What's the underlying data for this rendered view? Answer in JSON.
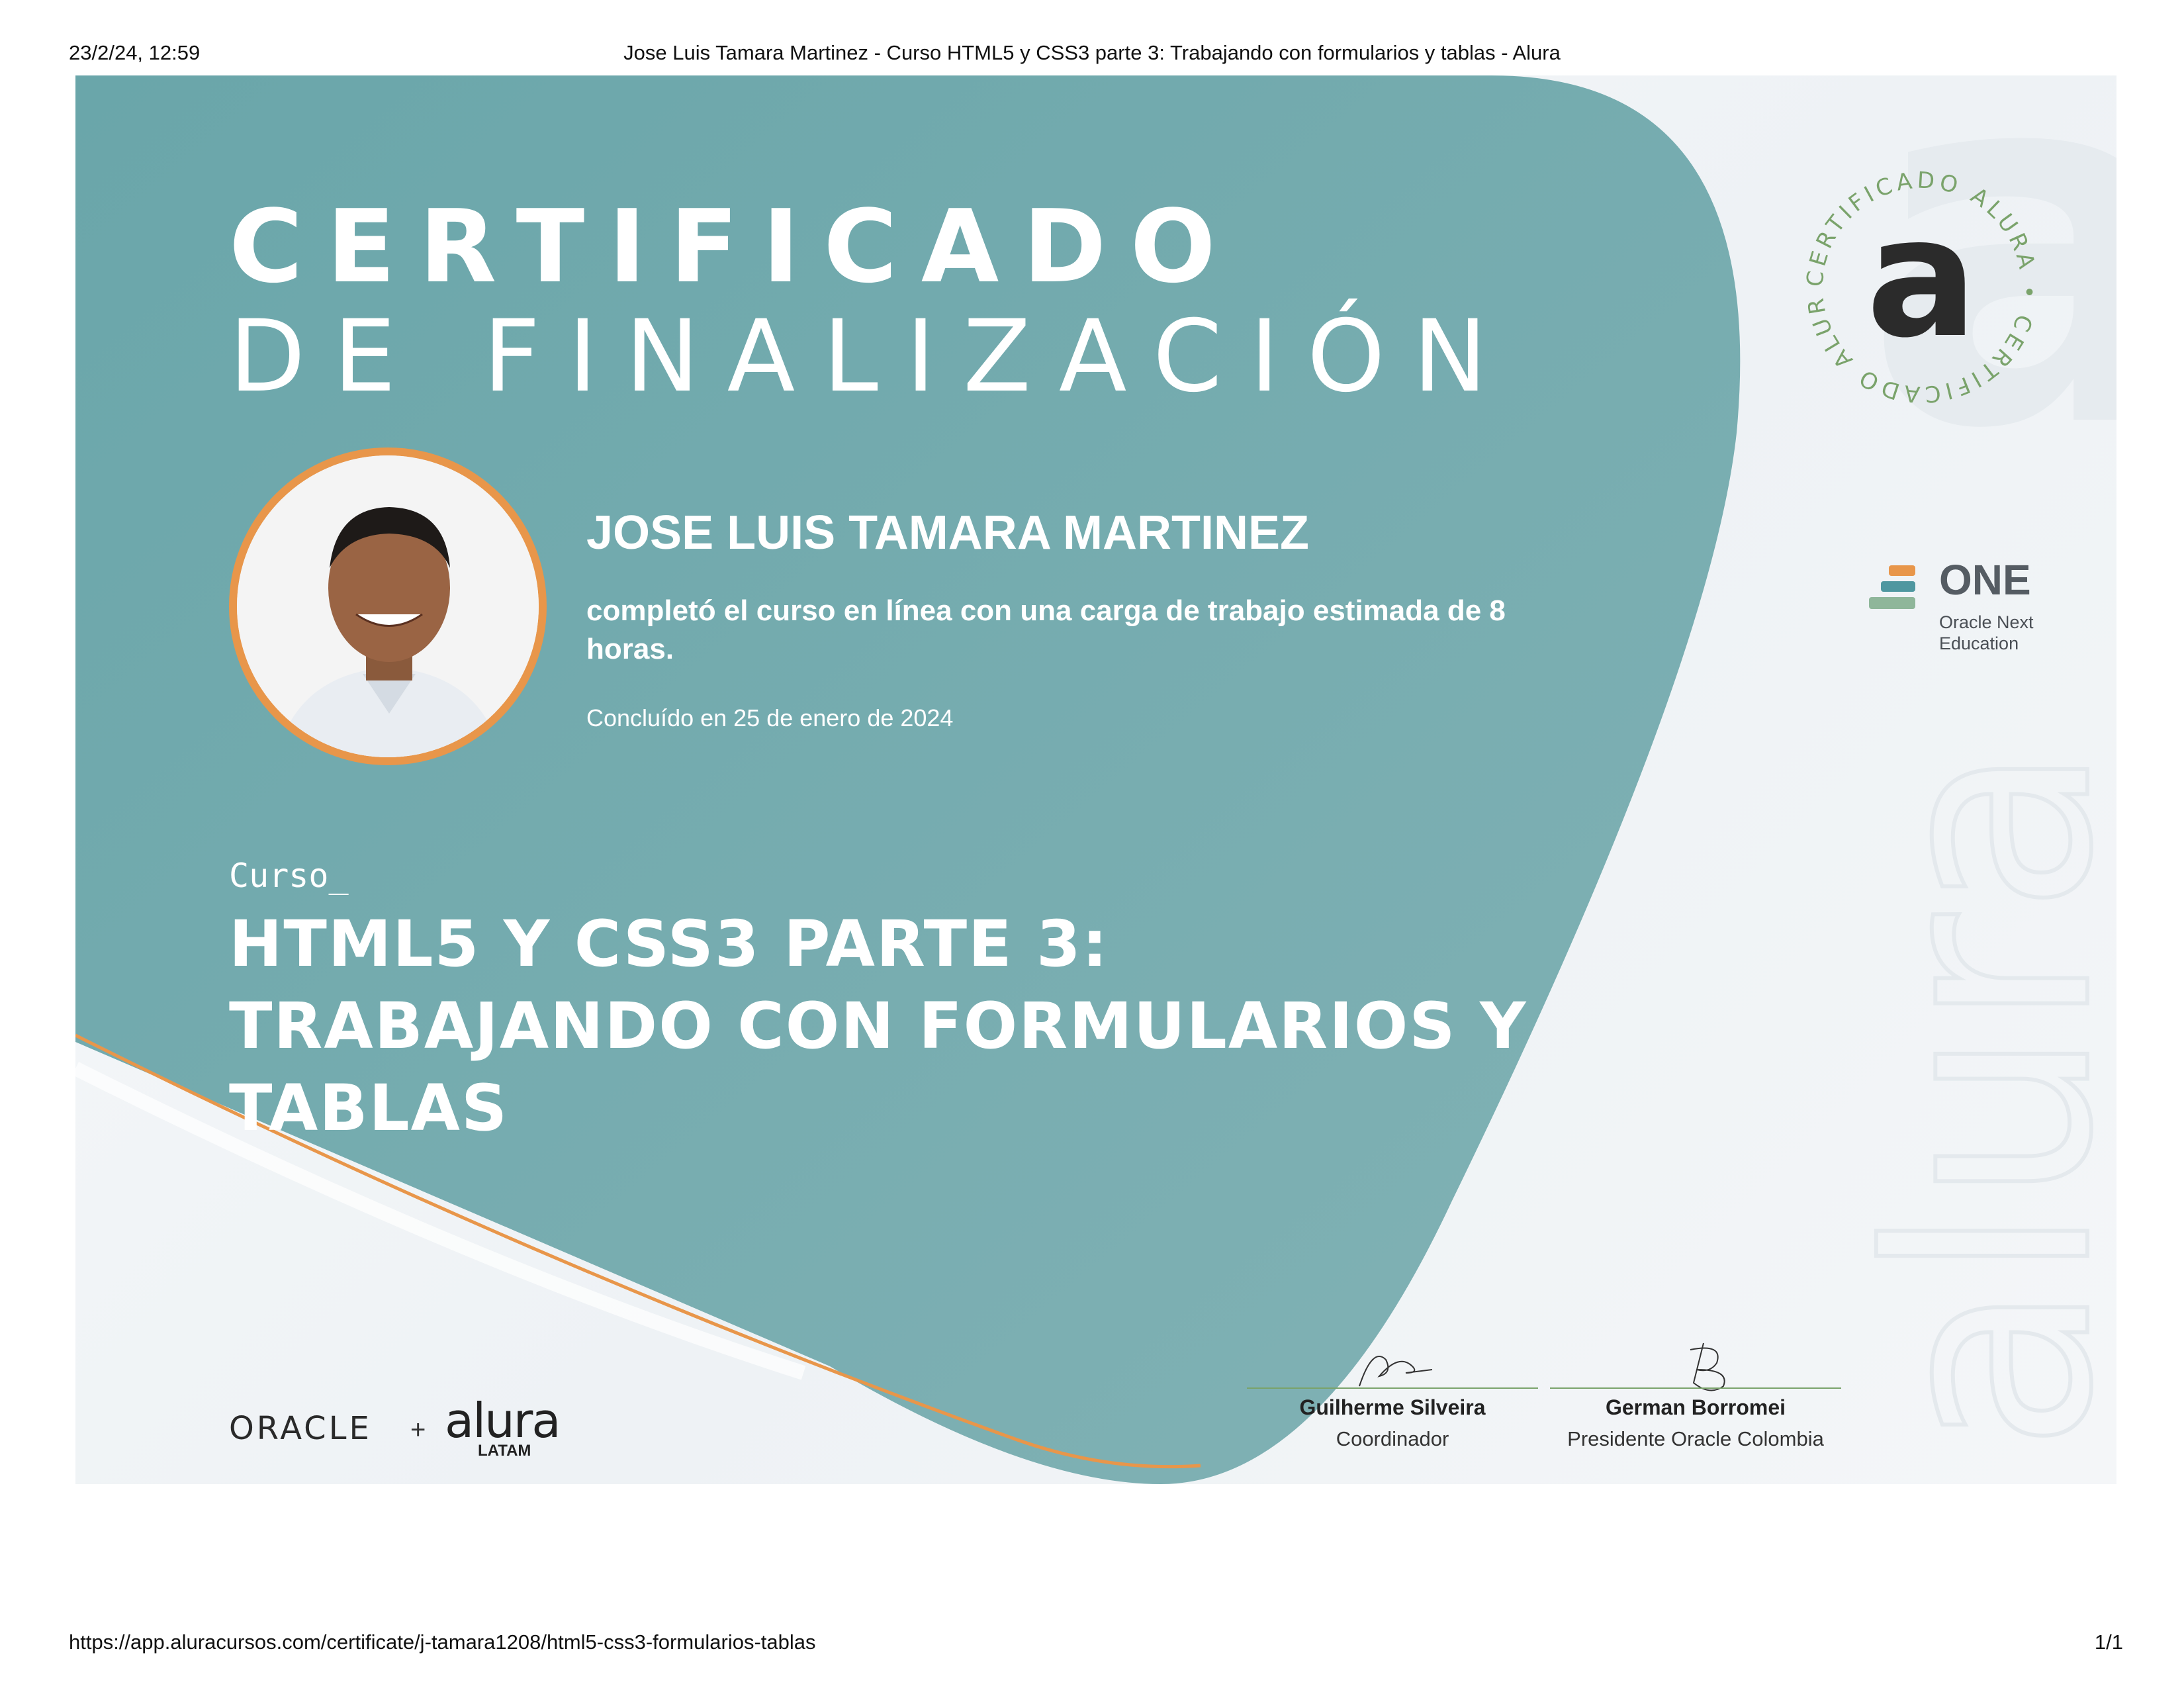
{
  "print_header": {
    "datetime": "23/2/24, 12:59",
    "title": "Jose Luis Tamara Martinez - Curso HTML5 y CSS3 parte 3: Trabajando con formularios y tablas - Alura"
  },
  "print_footer": {
    "url": "https://app.aluracursos.com/certificate/j-tamara1208/html5-css3-formularios-tablas",
    "page": "1/1"
  },
  "certificate": {
    "title_main": "CERTIFICADO",
    "title_sub": "DE FINALIZACIÓN",
    "student_name": "JOSE LUIS TAMARA MARTINEZ",
    "completed_text": "completó el curso en línea con una carga de trabajo estimada de 8 horas.",
    "concluded": "Concluído en 25 de enero de 2024",
    "course_label": "Curso_",
    "course_name": "HTML5 Y CSS3 PARTE 3: TRABAJANDO CON FORMULARIOS Y TABLAS"
  },
  "seal": {
    "ring_text": "CERTIFICADO ALURA • CERTIFICADO ALURA •",
    "letter": "a"
  },
  "one_logo": {
    "title": "ONE",
    "subtitle": "Oracle Next Education"
  },
  "signatures": [
    {
      "name": "Guilherme Silveira",
      "role": "Coordinador"
    },
    {
      "name": "German Borromei",
      "role": "Presidente Oracle Colombia"
    }
  ],
  "brands": {
    "oracle": "ORACLE",
    "plus": "+",
    "alura": "alura",
    "latam": "LATAM"
  },
  "colors": {
    "teal": "#6fa8ab",
    "orange": "#e8964a",
    "seal_green": "#7aa36b"
  }
}
